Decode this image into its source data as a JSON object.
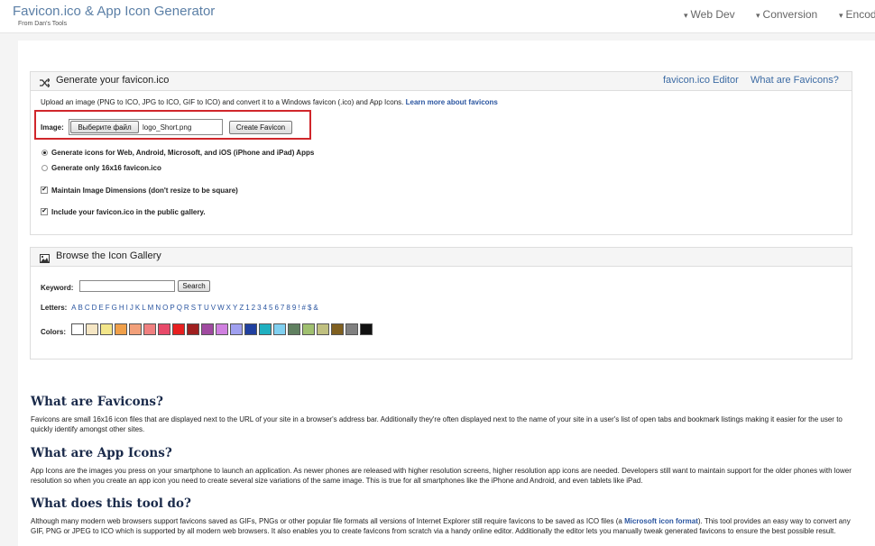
{
  "header": {
    "brand_title": "Favicon.ico & App Icon Generator",
    "brand_sub": "From Dan's Tools",
    "nav": [
      "Web Dev",
      "Conversion",
      "Encod"
    ]
  },
  "generate_panel": {
    "title": "Generate your favicon.ico",
    "links": [
      "favicon.ico Editor",
      "What are Favicons?"
    ],
    "intro": "Upload an image (PNG to ICO, JPG to ICO, GIF to ICO) and convert it to a Windows favicon (.ico) and App Icons.",
    "learn_more": "Learn more about favicons",
    "image_label": "Image:",
    "choose_file_label": "Выберите файл",
    "file_name": "logo_Short.png",
    "create_button": "Create Favicon",
    "option_all": "Generate icons for Web, Android, Microsoft, and iOS (iPhone and iPad) Apps",
    "option_16": "Generate only 16x16 favicon.ico",
    "maintain_dims": "Maintain Image Dimensions (don't resize to be square)",
    "public_gallery": "Include your favicon.ico in the public gallery.",
    "selected_option": "option_all",
    "maintain_checked": true,
    "gallery_checked": true
  },
  "gallery_panel": {
    "title": "Browse the Icon Gallery",
    "keyword_label": "Keyword:",
    "keyword_value": "",
    "search_button": "Search",
    "letters_label": "Letters:",
    "letters": [
      "A",
      "B",
      "C",
      "D",
      "E",
      "F",
      "G",
      "H",
      "I",
      "J",
      "K",
      "L",
      "M",
      "N",
      "O",
      "P",
      "Q",
      "R",
      "S",
      "T",
      "U",
      "V",
      "W",
      "X",
      "Y",
      "Z",
      "1",
      "2",
      "3",
      "4",
      "5",
      "6",
      "7",
      "8",
      "9",
      "!",
      "#",
      "$",
      "&"
    ],
    "colors_label": "Colors:",
    "colors": [
      "#ffffff",
      "#f5e6c4",
      "#f3e68a",
      "#f0a04a",
      "#f2a07a",
      "#f08080",
      "#e84a6a",
      "#e82020",
      "#a02020",
      "#a04aa0",
      "#d080e0",
      "#a0a0f0",
      "#2040a0",
      "#20b0c0",
      "#80d0f0",
      "#608060",
      "#a0c070",
      "#c0c080",
      "#806020",
      "#808080",
      "#111111"
    ]
  },
  "sections": [
    {
      "heading": "What are Favicons?",
      "body": "Favicons are small 16x16 icon files that are displayed next to the URL of your site in a browser's address bar. Additionally they're often displayed next to the name of your site in a user's list of open tabs and bookmark listings making it easier for the user to quickly identify amongst other sites."
    },
    {
      "heading": "What are App Icons?",
      "body": "App Icons are the images you press on your smartphone to launch an application. As newer phones are released with higher resolution screens, higher resolution app icons are needed. Developers still want to maintain support for the older phones with lower resolution so when you create an app icon you need to create several size variations of the same image. This is true for all smartphones like the iPhone and Android, and even tablets like iPad."
    },
    {
      "heading": "What does this tool do?",
      "body_before": "Although many modern web browsers support favicons saved as GIFs, PNGs or other popular file formats all versions of Internet Explorer still require favicons to be saved as ICO files (a",
      "body_link": "Microsoft icon format",
      "body_after": "). This tool provides an easy way to convert any GIF, PNG or JPEG to ICO which is supported by all modern web browsers. It also enables you to create favicons from scratch via a handy online editor. Additionally the editor lets you manually tweak generated favicons to ensure the best possible result."
    }
  ]
}
